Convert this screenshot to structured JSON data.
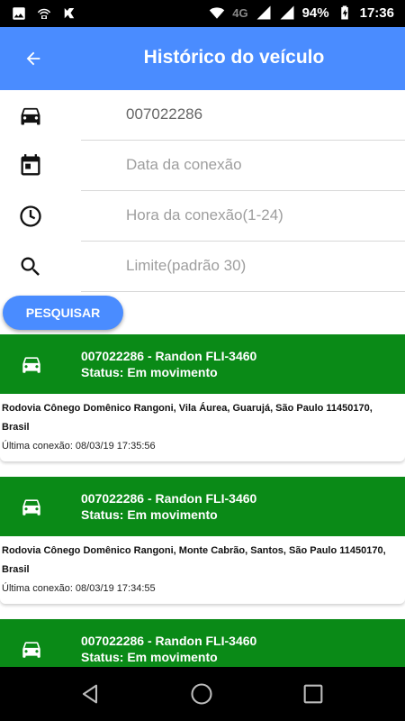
{
  "status_bar": {
    "network": "4G",
    "battery": "94%",
    "time": "17:36"
  },
  "app_bar": {
    "title": "Histórico do veículo"
  },
  "form": {
    "vehicle_value": "007022286",
    "date_placeholder": "Data da conexão",
    "hour_placeholder": "Hora da conexão(1-24)",
    "limit_placeholder": "Limite(padrão 30)"
  },
  "search_button": "PESQUISAR",
  "results": [
    {
      "title": "007022286 - Randon FLI-3460",
      "status": "Status: Em movimento",
      "address": "Rodovia Cônego Domênico Rangoni, Vila Áurea, Guarujá, São Paulo 11450170, Brasil",
      "last_connection": "Última conexão: 08/03/19 17:35:56"
    },
    {
      "title": "007022286 - Randon FLI-3460",
      "status": "Status: Em movimento",
      "address": "Rodovia Cônego Domênico Rangoni, Monte Cabrão, Santos, São Paulo 11450170, Brasil",
      "last_connection": "Última conexão: 08/03/19 17:34:55"
    },
    {
      "title": "007022286 - Randon FLI-3460",
      "status": "Status: Em movimento",
      "address": "",
      "last_connection": ""
    }
  ],
  "colors": {
    "primary": "#4a8cff",
    "card_header": "#0a8a17"
  }
}
